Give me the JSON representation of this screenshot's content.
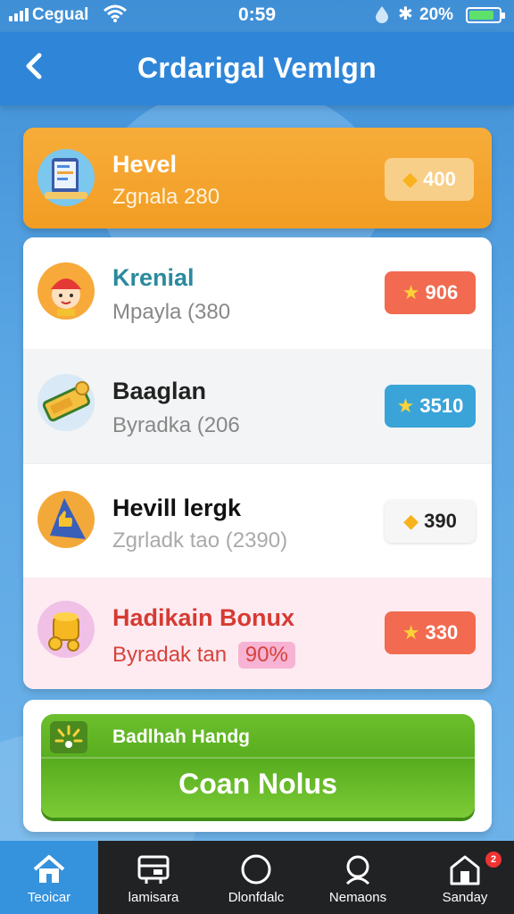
{
  "status_bar": {
    "carrier": "Cegual",
    "time": "0:59",
    "battery_pct": "20%",
    "battery_level": 0.85
  },
  "header": {
    "title": "Crdarigal Vemlgn"
  },
  "featured": {
    "title": "Hevel",
    "subtitle": "Zgnala 280",
    "badge": "400"
  },
  "rows": [
    {
      "title": "Krenial",
      "subtitle": "Mpayla (380",
      "badge": "906"
    },
    {
      "title": "Baaglan",
      "subtitle": "Byradka (206",
      "badge": "3510"
    },
    {
      "title": "Hevill lergk",
      "subtitle": "Zgrladk tao (2390)",
      "badge": "390"
    },
    {
      "title": "Hadikain Bonux",
      "subtitle": "Byradak tan",
      "subtitle_tag": "90%",
      "badge": "330"
    }
  ],
  "cta": {
    "hint": "Badlhah Handg",
    "button": "Coan Nolus"
  },
  "nav": [
    {
      "label": "Teoicar",
      "icon": "home-icon"
    },
    {
      "label": "lamisara",
      "icon": "media-icon"
    },
    {
      "label": "Dlonfdalc",
      "icon": "circle-icon"
    },
    {
      "label": "Nemaons",
      "icon": "search-icon"
    },
    {
      "label": "Sanday",
      "icon": "store-icon",
      "badge": "2"
    }
  ],
  "colors": {
    "header": "#2f86d8",
    "featured": "#f29d24",
    "badge_red": "#f26a4f",
    "badge_blue": "#3aa4d8",
    "cta_green": "#6cbf2c",
    "nav_bg": "#212224",
    "nav_active": "#3592dd"
  }
}
